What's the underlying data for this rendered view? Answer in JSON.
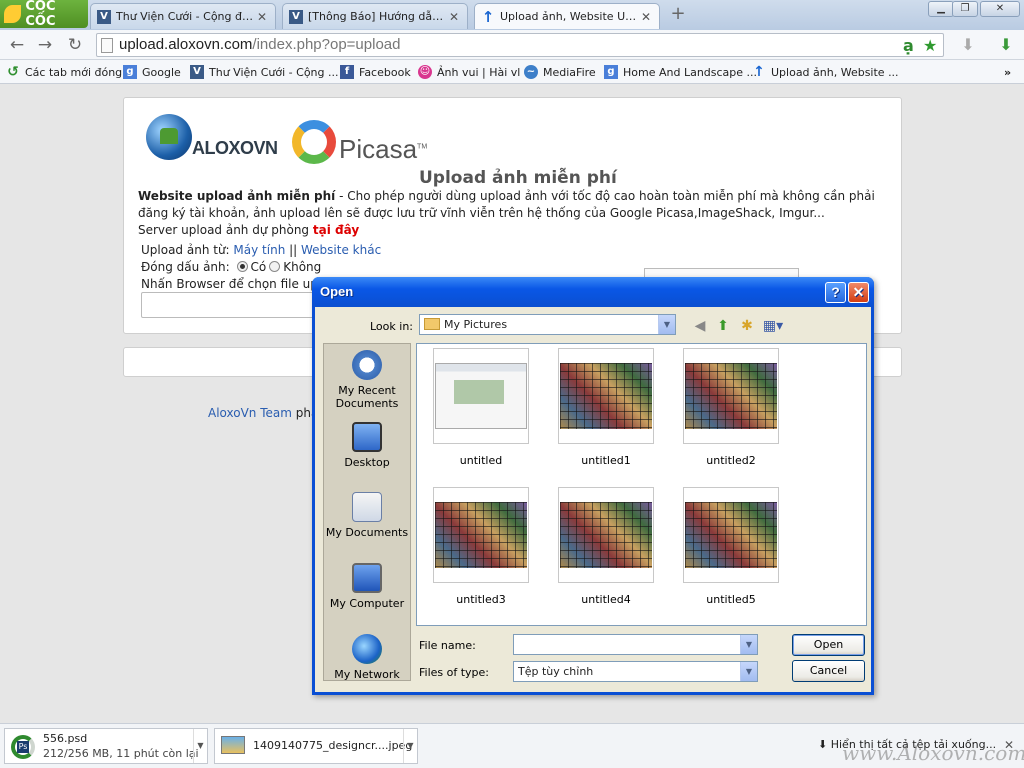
{
  "browser": {
    "brand": "CỐC CỐC",
    "tabs": [
      {
        "title": "Thư Viện Cưới - Cộng đồng th",
        "active": false
      },
      {
        "title": "[Thông Báo] Hướng dẫn cách",
        "active": false
      },
      {
        "title": "Upload ảnh, Website Upload",
        "active": true
      }
    ],
    "url_domain": "upload.aloxovn.com",
    "url_path": "/index.php?op=upload",
    "bookmarks": [
      "Các tab mới đóng",
      "Google",
      "Thư Viện Cưới - Cộng ...",
      "Facebook",
      "Ảnh vui | Hài vl",
      "MediaFire",
      "Home And Landscape ...",
      "Upload ảnh, Website ..."
    ],
    "more_bookmarks": "»"
  },
  "page": {
    "brand": "ALOXOVN",
    "picasa": "Picasa",
    "picasa_tm": "TM",
    "heading": "Upload ảnh miễn phí",
    "desc_bold": "Website upload ảnh miễn phí",
    "desc_rest": " - Cho phép người dùng upload ảnh với tốc độ cao hoàn toàn miễn phí mà không cần phải đăng ký tài khoản, ảnh upload lên sẽ được lưu trữ vĩnh viễn trên hệ thống của Google Picasa,ImageShack, Imgur...",
    "backup_text": "Server upload ảnh dự phòng ",
    "backup_link": "tại đây",
    "source_label": "Upload ảnh từ: ",
    "source_computer": "Máy tính",
    "source_sep": " || ",
    "source_web": "Website khác",
    "watermark_label": "Đóng dấu ảnh: ",
    "watermark_yes": "Có",
    "watermark_no": "Không",
    "browse_hint": "Nhấn Browser để chọn file uplo",
    "footer_team": "AloxoVn Team",
    "footer_rest": " phâ"
  },
  "dialog": {
    "title": "Open",
    "help": "?",
    "close": "✕",
    "look_in_label": "Look in:",
    "look_in_value": "My Pictures",
    "places": [
      "My Recent Documents",
      "Desktop",
      "My Documents",
      "My Computer",
      "My Network"
    ],
    "files": [
      "untitled",
      "untitled1",
      "untitled2",
      "untitled3",
      "untitled4",
      "untitled5"
    ],
    "file_name_label": "File name:",
    "file_name_value": "",
    "file_type_label": "Files of type:",
    "file_type_value": "Tệp tùy chỉnh",
    "open_button": "Open",
    "cancel_button": "Cancel"
  },
  "downloads": [
    {
      "name": "556.psd",
      "status": "212/256 MB, 11 phút còn lại"
    },
    {
      "name": "1409140775_designcr....jpeg",
      "status": ""
    }
  ],
  "show_all_downloads": "Hiển thị tất cả tệp tải xuống...",
  "watermark": "www.Aloxovn.com"
}
